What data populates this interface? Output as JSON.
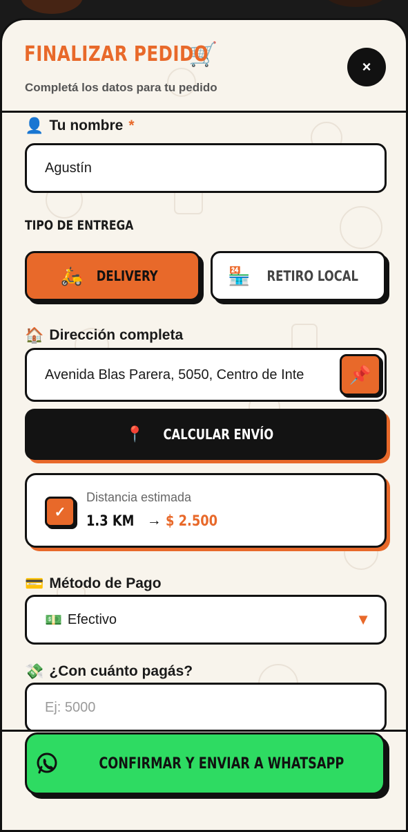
{
  "header": {
    "title": "FINALIZAR PEDIDO",
    "title_icon": "🛒",
    "subtitle": "Completá los datos para tu pedido",
    "close_label": "×"
  },
  "name_field": {
    "icon": "👤",
    "label": "Tu nombre",
    "required_mark": "*",
    "value": "Agustín"
  },
  "delivery_type": {
    "caption": "TIPO DE ENTREGA",
    "options": [
      {
        "icon": "🛵",
        "label": "DELIVERY",
        "selected": true
      },
      {
        "icon": "🏪",
        "label": "RETIRO LOCAL",
        "selected": false
      }
    ]
  },
  "address_field": {
    "icon": "🏠",
    "label": "Dirección completa",
    "value": "Avenida Blas Parera, 5050, Centro de Inte",
    "pin_icon": "📌"
  },
  "calc_button": {
    "icon": "📍",
    "label": "CALCULAR ENVÍO"
  },
  "distance_card": {
    "check_icon": "✓",
    "label": "Distancia estimada",
    "distance": "1.3 KM",
    "arrow": "→",
    "price": "$ 2.500"
  },
  "payment_field": {
    "icon": "💳",
    "label": "Método de Pago",
    "selected_icon": "💵",
    "selected_value": "Efectivo",
    "caret": "▼"
  },
  "cash_field": {
    "icon": "💸",
    "label": "¿Con cuánto pagás?",
    "placeholder": "Ej: 5000"
  },
  "submit": {
    "label": "CONFIRMAR Y ENVIAR A WHATSAPP"
  },
  "colors": {
    "accent": "#e8692a",
    "background": "#f8f4ec",
    "whatsapp": "#2edb62",
    "dark": "#111111"
  }
}
